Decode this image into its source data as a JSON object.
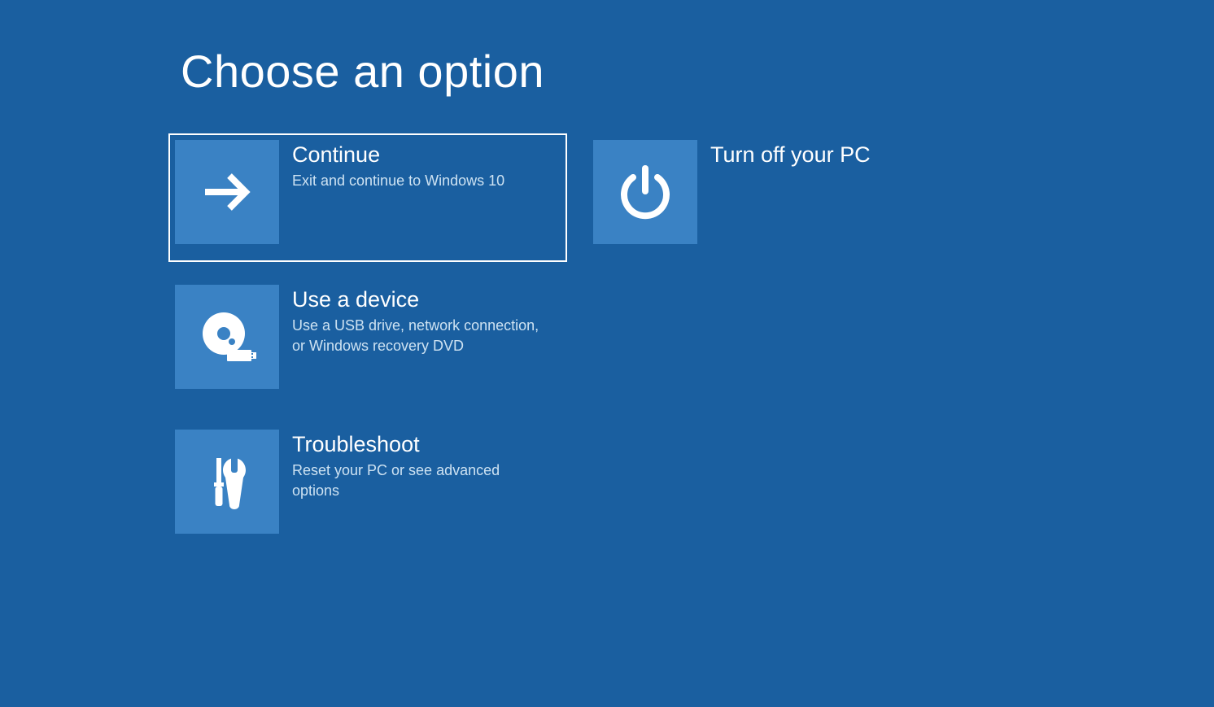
{
  "title": "Choose an option",
  "options": {
    "continue": {
      "title": "Continue",
      "subtitle": "Exit and continue to Windows 10"
    },
    "turnoff": {
      "title": "Turn off your PC",
      "subtitle": ""
    },
    "useadevice": {
      "title": "Use a device",
      "subtitle": "Use a USB drive, network connection, or Windows recovery DVD"
    },
    "troubleshoot": {
      "title": "Troubleshoot",
      "subtitle": "Reset your PC or see advanced options"
    }
  }
}
